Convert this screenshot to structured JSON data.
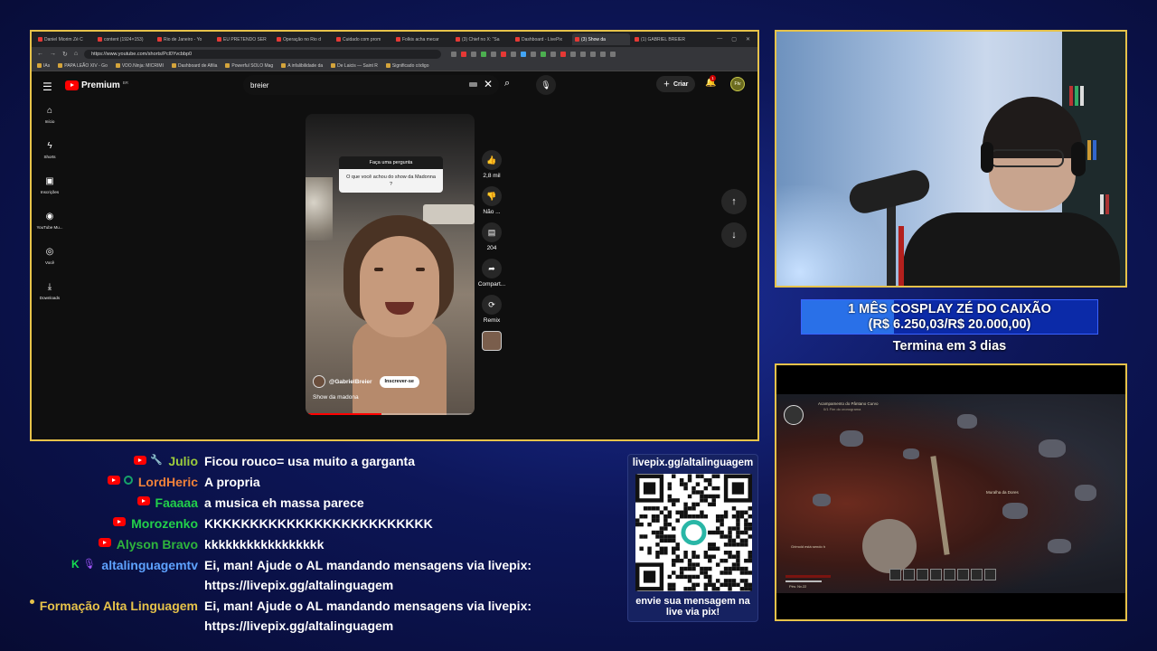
{
  "browser": {
    "tabs": [
      {
        "label": "Daniel Miorim Zé C",
        "active": false
      },
      {
        "label": "content (1924×153)",
        "active": false
      },
      {
        "label": "Rio de Janeiro - Yo",
        "active": false
      },
      {
        "label": "EU PRETENDO SER",
        "active": false
      },
      {
        "label": "Operação no Rio d",
        "active": false
      },
      {
        "label": "Cuidado com prom",
        "active": false
      },
      {
        "label": "Folkis acha mecar",
        "active": false
      },
      {
        "label": "(3) Chief no X: \"Sa",
        "active": false
      },
      {
        "label": "Dashboard - LivePix",
        "active": false
      },
      {
        "label": "(3) Show da",
        "active": true
      },
      {
        "label": "(1) GABRIEL BREIER",
        "active": false
      }
    ],
    "url": "https://www.youtube.com/shorts/Pcl0Yvcbbp0",
    "bookmarks": [
      "IAs",
      "PAPA LEÃO XIV - Go",
      "VDO.Ninja: MICRIMI",
      "Dashboard de Afilia",
      "Powerful SOLO Mag",
      "A infalibilidade da",
      "De Laicis — Saint R",
      "Significado código"
    ]
  },
  "youtube": {
    "logo_text": "Premium",
    "logo_region": "BR",
    "search_value": "breier",
    "create_label": "Criar",
    "notif_count": "1",
    "avatar_text": "Ftv",
    "sidenav": [
      {
        "icon": "home-icon",
        "glyph": "⌂",
        "label": "Início"
      },
      {
        "icon": "shorts-icon",
        "glyph": "ϟ",
        "label": "Shorts"
      },
      {
        "icon": "subscriptions-icon",
        "glyph": "▣",
        "label": "Inscrições"
      },
      {
        "icon": "youtube-music-icon",
        "glyph": "◉",
        "label": "YouTube Mu..."
      },
      {
        "icon": "you-icon",
        "glyph": "◎",
        "label": "Você"
      },
      {
        "icon": "downloads-icon",
        "glyph": "⤓",
        "label": "Downloads"
      }
    ],
    "short": {
      "question_header": "Faça uma pergunta",
      "question_body": "O que você achou do show da Madonna ?",
      "channel": "@GabrielBreier",
      "subscribe_label": "Inscrever-se",
      "caption": "Show da madona",
      "progress": 0.45
    },
    "actions": [
      {
        "icon": "like-icon",
        "glyph": "👍",
        "label": "2,8 mil"
      },
      {
        "icon": "dislike-icon",
        "glyph": "👎",
        "label": "Não ..."
      },
      {
        "icon": "comment-icon",
        "glyph": "▤",
        "label": "204"
      },
      {
        "icon": "share-icon",
        "glyph": "➦",
        "label": "Compart..."
      },
      {
        "icon": "remix-icon",
        "glyph": "⟳",
        "label": "Remix"
      }
    ]
  },
  "goal": {
    "title": "1 MÊS COSPLAY ZÉ DO CAIXÃO",
    "amount": "(R$ 6.250,03/R$ 20.000,00)",
    "progress": 0.3125,
    "ends": "Termina em 3 dias"
  },
  "game": {
    "quest": "Acampamento do Pântano Curvo",
    "quest_sub": "0/1 Fim do cronograma",
    "label": "Muralha da Dores",
    "status": "Grimold está sendo h",
    "status2": "Pés: Nv.22"
  },
  "chat": [
    {
      "badges": [
        "youtube",
        "wrench"
      ],
      "user": "Julio",
      "color": "#9ccc3c",
      "text": "Ficou rouco= usa muito a garganta"
    },
    {
      "badges": [
        "youtube",
        "circle"
      ],
      "user": "LordHeric",
      "color": "#f0813a",
      "text": "A propria"
    },
    {
      "badges": [
        "youtube"
      ],
      "user": "Faaaaa",
      "color": "#22d04a",
      "text": "a musica eh massa parece"
    },
    {
      "badges": [
        "youtube"
      ],
      "user": "Morozenko",
      "color": "#22d04a",
      "text": "KKKKKKKKKKKKKKKKKKKKKKKKK"
    },
    {
      "badges": [
        "youtube"
      ],
      "user": "Alyson Bravo",
      "color": "#2eb43c",
      "text": "kkkkkkkkkkkkkkkkk"
    },
    {
      "badges": [
        "k",
        "mic"
      ],
      "user": "altalinguagemtv",
      "color": "#5ea2ff",
      "text": "Ei, man! Ajude o AL mandando mensagens via livepix: https://livepix.gg/altalinguagem"
    },
    {
      "badges": [
        "dot"
      ],
      "user": "Formação Alta Linguagem",
      "color": "#e6c24a",
      "text": "Ei, man! Ajude o AL mandando mensagens via livepix: https://livepix.gg/altalinguagem"
    }
  ],
  "qr": {
    "title": "livepix.gg/altalinguagem",
    "caption": "envie sua mensagem na live via pix!"
  }
}
